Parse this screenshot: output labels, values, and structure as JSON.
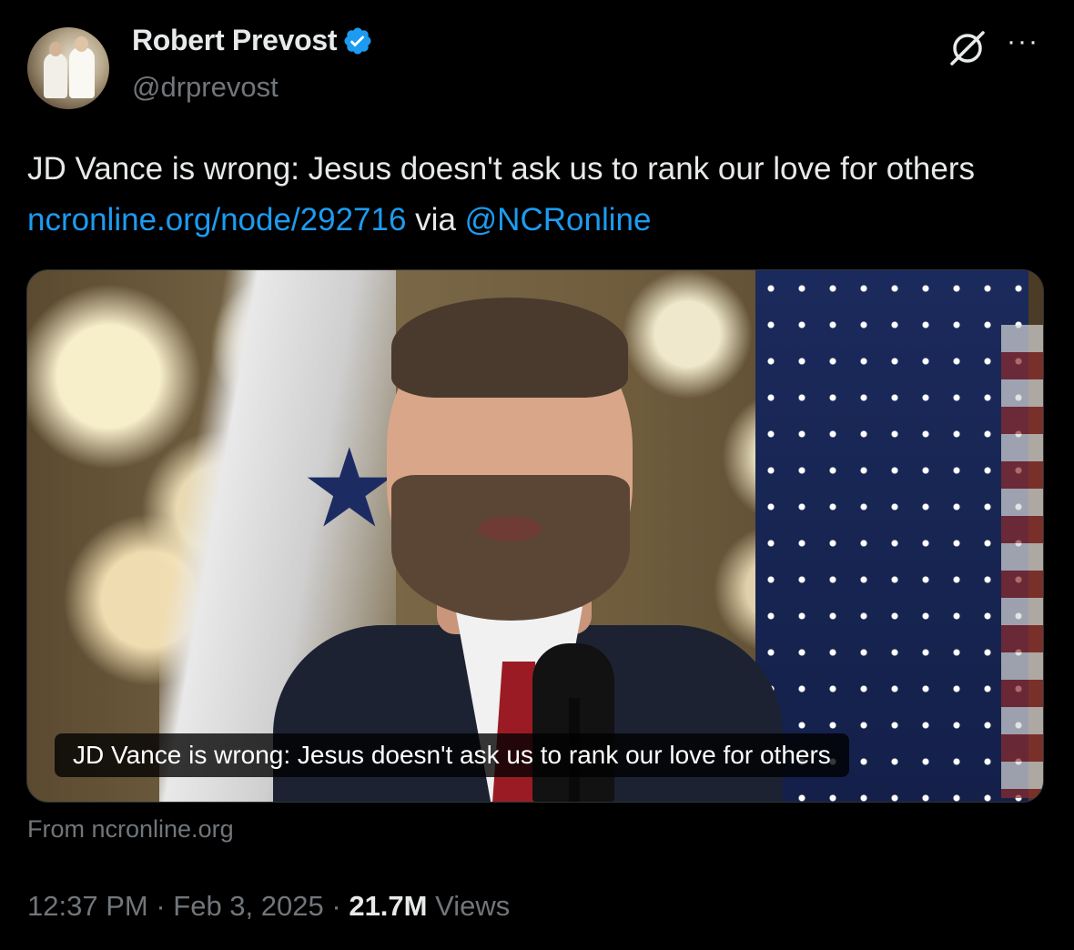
{
  "author": {
    "display_name": "Robert Prevost",
    "handle": "@drprevost",
    "verified": true,
    "verified_color": "#1d9bf0",
    "avatar_icon": "profile-photo"
  },
  "actions": {
    "grok_icon": "grok-icon",
    "more_label": "···"
  },
  "tweet": {
    "text_before": "JD Vance is wrong: Jesus doesn't ask us to rank our love for others ",
    "link_text": "ncronline.org/node/292716",
    "text_mid": " via ",
    "mention": "@NCRonline",
    "link_color": "#1d9bf0"
  },
  "card": {
    "caption": "JD Vance is wrong: Jesus doesn't ask us to rank our love for others",
    "from": "From ncronline.org"
  },
  "meta": {
    "time": "12:37 PM",
    "separator": "·",
    "date": "Feb 3, 2025",
    "views_count": "21.7M",
    "views_label": "Views"
  }
}
